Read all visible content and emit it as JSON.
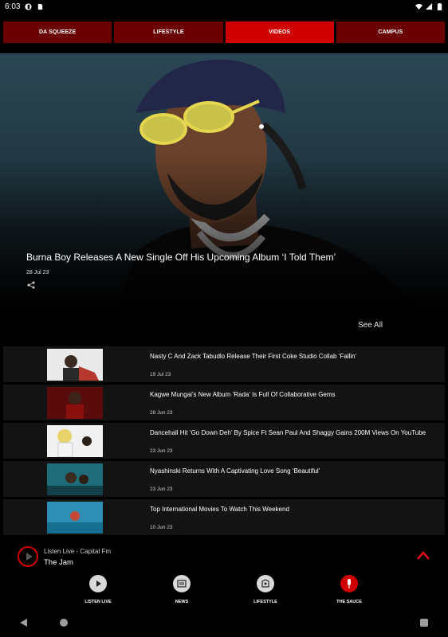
{
  "status_bar": {
    "time": "6:03"
  },
  "tabs": [
    {
      "label": "DA SQUEEZE",
      "active": false
    },
    {
      "label": "LIFESTYLE",
      "active": false
    },
    {
      "label": "VIDEOS",
      "active": true
    },
    {
      "label": "CAMPUS",
      "active": false
    }
  ],
  "hero": {
    "title": "Burna Boy Releases A New Single Off His Upcoming Album ‘I Told Them’",
    "date": "28 Jul 23",
    "share_icon": "share-icon"
  },
  "see_all": "See All",
  "articles": [
    {
      "title": "Nasty C And Zack Tabudlo Release Their First Coke Studio Collab ‘Fallin’",
      "date": "19 Jul 23"
    },
    {
      "title": "Kagwe Mungai’s New Album ‘Rada’ Is Full Of Collaborative Gems",
      "date": "28 Jun 23"
    },
    {
      "title": "Dancehall Hit ‘Go Down Deh’ By Spice Ft Sean Paul And Shaggy Gains 200M Views On YouTube",
      "date": "23 Jun 23"
    },
    {
      "title": "Nyashinski Returns With A Captivating Love Song ‘Beautiful’",
      "date": "23 Jun 23"
    },
    {
      "title": "Top International Movies To Watch This Weekend",
      "date": "10 Jun 23"
    }
  ],
  "player": {
    "label": "Listen Live - Capital Fm",
    "show": "The Jam"
  },
  "bottom_nav": [
    {
      "label": "LISTEN LIVE",
      "icon": "play-icon"
    },
    {
      "label": "NEWS",
      "icon": "news-icon"
    },
    {
      "label": "LIFESTYLE",
      "icon": "lifestyle-icon"
    },
    {
      "label": "THE SAUCE",
      "icon": "mic-icon"
    }
  ],
  "colors": {
    "accent": "#d10000",
    "tab_inactive": "#6b0000",
    "row_bg": "#131313"
  }
}
